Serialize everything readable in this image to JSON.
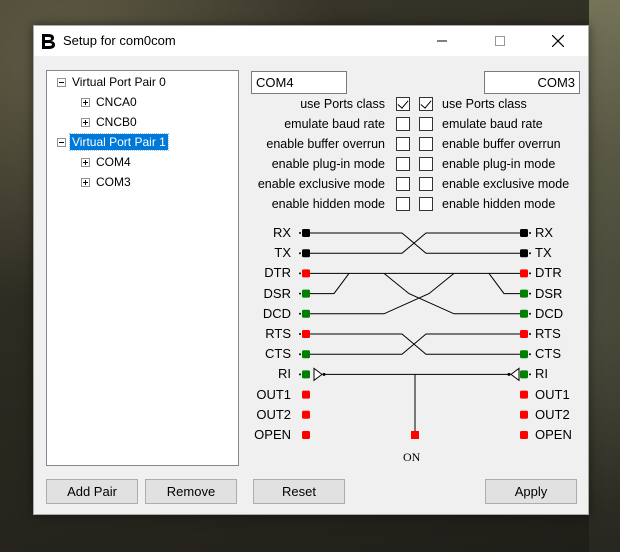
{
  "window": {
    "title": "Setup for com0com"
  },
  "tree": {
    "items": [
      {
        "label": "Virtual Port Pair 0",
        "expander": "minus",
        "selected": false
      },
      {
        "label": "CNCA0",
        "expander": "plus",
        "selected": false
      },
      {
        "label": "CNCB0",
        "expander": "plus",
        "selected": false
      },
      {
        "label": "Virtual Port Pair 1",
        "expander": "minus",
        "selected": true
      },
      {
        "label": "COM4",
        "expander": "plus",
        "selected": false
      },
      {
        "label": "COM3",
        "expander": "plus",
        "selected": false
      }
    ]
  },
  "buttons": {
    "add_pair": "Add Pair",
    "remove": "Remove",
    "reset": "Reset",
    "apply": "Apply"
  },
  "ports": {
    "left_name": "COM4",
    "right_name": "COM3"
  },
  "options": [
    {
      "label": "use Ports class",
      "left_checked": true,
      "right_checked": true
    },
    {
      "label": "emulate baud rate",
      "left_checked": false,
      "right_checked": false
    },
    {
      "label": "enable buffer overrun",
      "left_checked": false,
      "right_checked": false
    },
    {
      "label": "enable plug-in mode",
      "left_checked": false,
      "right_checked": false
    },
    {
      "label": "enable exclusive mode",
      "left_checked": false,
      "right_checked": false
    },
    {
      "label": "enable hidden mode",
      "left_checked": false,
      "right_checked": false
    }
  ],
  "signals": {
    "left": [
      {
        "label": "RX",
        "color": "black"
      },
      {
        "label": "TX",
        "color": "black"
      },
      {
        "label": "DTR",
        "color": "red"
      },
      {
        "label": "DSR",
        "color": "green"
      },
      {
        "label": "DCD",
        "color": "green"
      },
      {
        "label": "RTS",
        "color": "red"
      },
      {
        "label": "CTS",
        "color": "green"
      },
      {
        "label": "RI",
        "color": "green"
      },
      {
        "label": "OUT1",
        "color": "red"
      },
      {
        "label": "OUT2",
        "color": "red"
      },
      {
        "label": "OPEN",
        "color": "red"
      }
    ],
    "right": [
      {
        "label": "RX",
        "color": "black"
      },
      {
        "label": "TX",
        "color": "black"
      },
      {
        "label": "DTR",
        "color": "red"
      },
      {
        "label": "DSR",
        "color": "green"
      },
      {
        "label": "DCD",
        "color": "green"
      },
      {
        "label": "RTS",
        "color": "red"
      },
      {
        "label": "CTS",
        "color": "green"
      },
      {
        "label": "RI",
        "color": "green"
      },
      {
        "label": "OUT1",
        "color": "red"
      },
      {
        "label": "OUT2",
        "color": "red"
      },
      {
        "label": "OPEN",
        "color": "red"
      }
    ],
    "on_label": "ON",
    "colors": {
      "black": "#000000",
      "red": "#ff0000",
      "green": "#008000"
    }
  }
}
